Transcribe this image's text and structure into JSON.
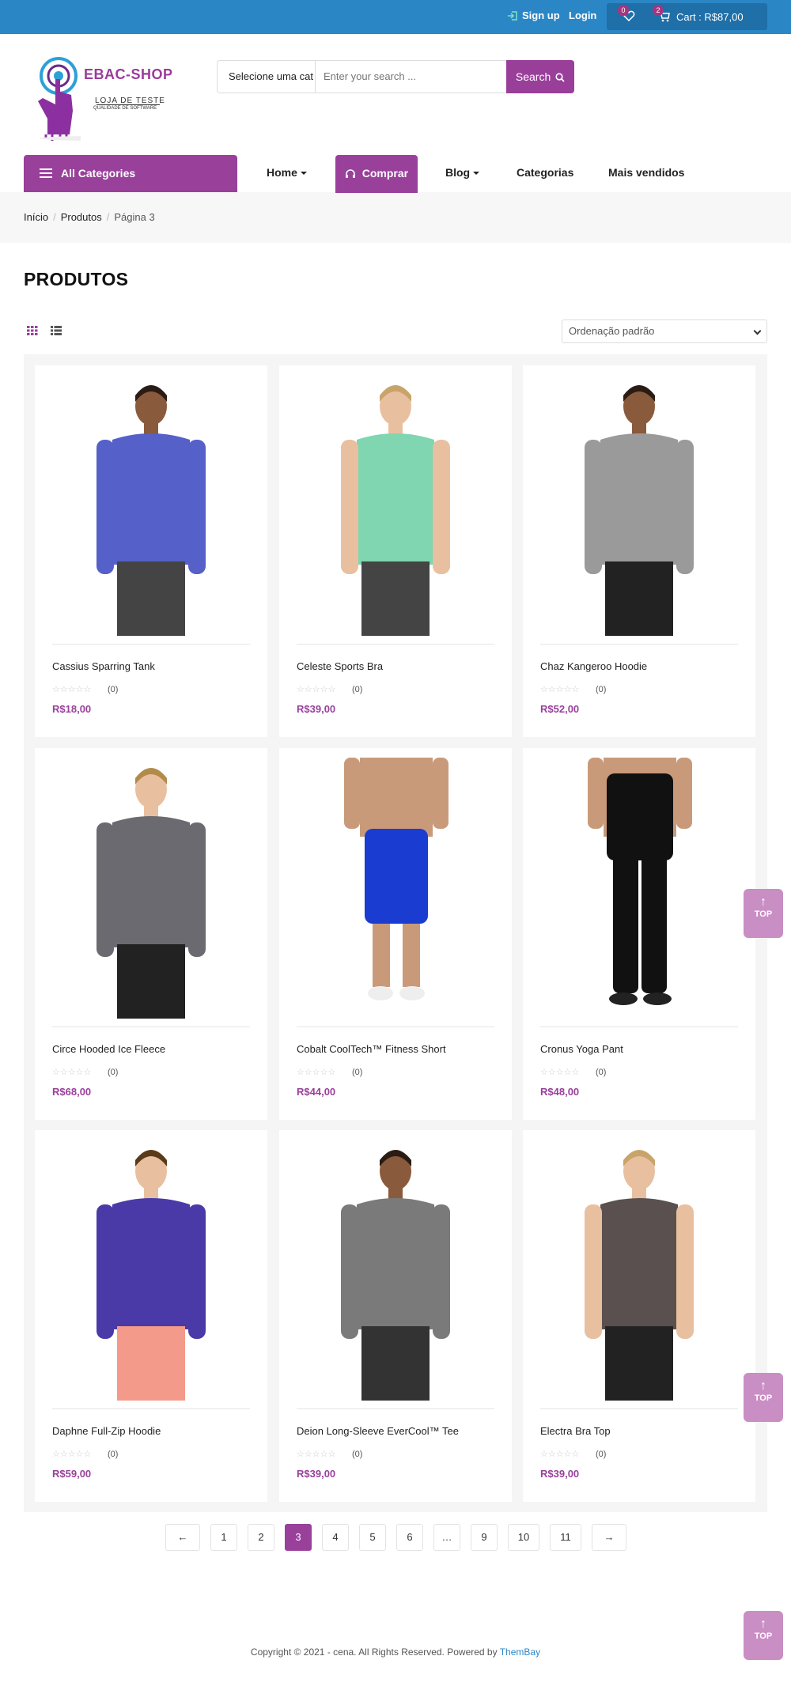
{
  "topbar": {
    "signup": "Sign up",
    "login": "Login",
    "wishlist_count": "0",
    "cart_count": "2",
    "cart_total": "Cart : R$87,00"
  },
  "logo": {
    "name": "EBAC-SHOP",
    "line1": "LOJA DE TESTE",
    "line2": "QUALIDADE DE SOFTWARE"
  },
  "search": {
    "category": "Selecione uma cat",
    "placeholder": "Enter your search ...",
    "button": "Search"
  },
  "nav": {
    "all_categories": "All Categories",
    "items": [
      "Home",
      "Comprar",
      "Blog",
      "Categorias",
      "Mais vendidos"
    ]
  },
  "breadcrumb": [
    "Início",
    "Produtos",
    "Página 3"
  ],
  "page_title": "PRODUTOS",
  "sort": {
    "selected": "Ordenação padrão"
  },
  "products": [
    {
      "name": "Cassius Sparring Tank",
      "rating_count": "(0)",
      "price": "R$18,00"
    },
    {
      "name": "Celeste Sports Bra",
      "rating_count": "(0)",
      "price": "R$39,00"
    },
    {
      "name": "Chaz Kangeroo Hoodie",
      "rating_count": "(0)",
      "price": "R$52,00"
    },
    {
      "name": "Circe Hooded Ice Fleece",
      "rating_count": "(0)",
      "price": "R$68,00"
    },
    {
      "name": "Cobalt CoolTech™ Fitness Short",
      "rating_count": "(0)",
      "price": "R$44,00"
    },
    {
      "name": "Cronus Yoga Pant",
      "rating_count": "(0)",
      "price": "R$48,00"
    },
    {
      "name": "Daphne Full-Zip Hoodie",
      "rating_count": "(0)",
      "price": "R$59,00"
    },
    {
      "name": "Deion Long-Sleeve EverCool™ Tee",
      "rating_count": "(0)",
      "price": "R$39,00"
    },
    {
      "name": "Electra Bra Top",
      "rating_count": "(0)",
      "price": "R$39,00"
    }
  ],
  "pagination": {
    "prev": "←",
    "pages": [
      "1",
      "2",
      "3",
      "4",
      "5",
      "6",
      "…",
      "9",
      "10",
      "11"
    ],
    "current": "3",
    "next": "→"
  },
  "back_to_top": "TOP",
  "footer": {
    "text": "Copyright © 2021 - cena. All Rights Reserved. Powered by ",
    "brand": "ThemBay"
  },
  "colors": {
    "topbar": "#2b86c5",
    "accent": "#99409b",
    "price": "#99409b"
  }
}
